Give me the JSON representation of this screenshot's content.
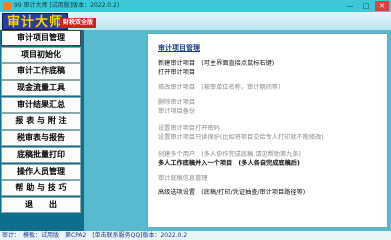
{
  "window": {
    "title": "99 审计大师 [试用版]版本：2022.0.2)",
    "icon": "app-icon",
    "controls": [
      "—",
      "□",
      "✕"
    ]
  },
  "banner": {
    "logo_text": "审计大师",
    "edition_badge": "财税双全版"
  },
  "sidebar": {
    "items": [
      {
        "label": "审计项目管理",
        "active": true
      },
      {
        "label": "项目初始化"
      },
      {
        "label": "审计工作底稿"
      },
      {
        "label": "现金流量工具"
      },
      {
        "label": "审计结果汇总"
      },
      {
        "label": "报 表 与 附 注"
      },
      {
        "label": "税审表与报告"
      },
      {
        "label": "底稿批量打印"
      },
      {
        "label": "操作人员管理"
      },
      {
        "label": "帮 助 与 技 巧"
      },
      {
        "label": "退　　出"
      }
    ]
  },
  "panel": {
    "title": "审计项目管理",
    "options": [
      {
        "label": "新建审计项目　(可主界面直接点鼠标右键)",
        "state": "active"
      },
      {
        "label": "打开审计项目",
        "state": "active"
      },
      {
        "label": "修改审计项目　(被审单位名称，审计期间等)",
        "state": "dim"
      },
      {
        "label": "删除审计项目",
        "state": "dim"
      },
      {
        "label": "审计项目备份",
        "state": "dim"
      },
      {
        "label": "设置审计项目打开密码",
        "state": "dim"
      },
      {
        "label": "设置审计项目只读保护(比如将项目交给专人打印就不能修改)",
        "state": "dim"
      },
      {
        "label": "创建多个用户　(多人协作完成底稿,请见帮助第九条)",
        "state": "dim"
      },
      {
        "label": "多人工作底稿并入一个项目　(多人各自完成底稿后)",
        "state": "strong"
      },
      {
        "label": "审计底稿信息管理",
        "state": "dim"
      },
      {
        "label": "高级选项设置　(底稿/打印/凭证抽查/审计项目路径等)",
        "state": "active"
      }
    ]
  },
  "statusbar": {
    "text": "审计：　模板：试用版　第CPA2　[单击联系服务QQ]版本：2022.0.2"
  }
}
